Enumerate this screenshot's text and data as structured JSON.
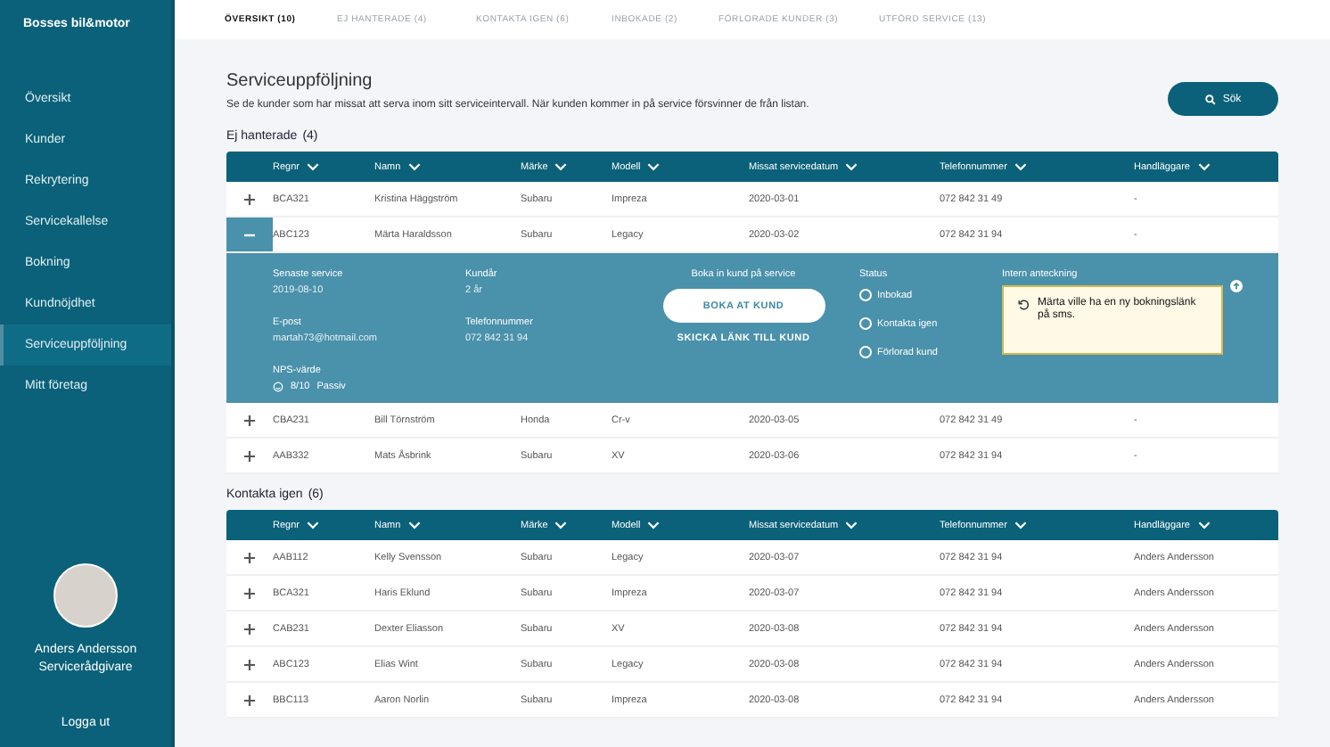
{
  "sidebar": {
    "brand": "Bosses bil&motor",
    "items": [
      {
        "label": "Översikt",
        "selected": false
      },
      {
        "label": "Kunder",
        "selected": false
      },
      {
        "label": "Rekrytering",
        "selected": false
      },
      {
        "label": "Servicekallelse",
        "selected": false
      },
      {
        "label": "Bokning",
        "selected": false
      },
      {
        "label": "Kundnöjdhet",
        "selected": false
      },
      {
        "label": "Serviceuppföljning",
        "selected": true
      },
      {
        "label": "Mitt företag",
        "selected": false
      }
    ],
    "user": {
      "name": "Anders Andersson",
      "role": "Servicerådgivare"
    },
    "logout": "Logga ut"
  },
  "tabs": [
    {
      "label": "ÖVERSIKT",
      "count": "(10)",
      "selected": true
    },
    {
      "label": "EJ HANTERADE",
      "count": "(4)",
      "selected": false
    },
    {
      "label": "KONTAKTA IGEN",
      "count": "(6)",
      "selected": false
    },
    {
      "label": "INBOKADE",
      "count": "(2)",
      "selected": false
    },
    {
      "label": "FÖRLORADE KUNDER",
      "count": "(3)",
      "selected": false
    },
    {
      "label": "UTFÖRD SERVICE",
      "count": "(13)",
      "selected": false
    }
  ],
  "page": {
    "title": "Serviceuppföljning",
    "description": "Se de kunder som har missat att serva inom sitt serviceintervall. När kunden kommer in på service försvinner de från listan.",
    "search_button": "Sök"
  },
  "sections": [
    {
      "title": "Ej hanterade",
      "count": "(4)",
      "columns": [
        "Regnr",
        "Namn",
        "Märke",
        "Modell",
        "Missat servicedatum",
        "Telefonnummer",
        "Handläggare"
      ],
      "rows": [
        {
          "expanded": false,
          "cells": [
            "BCA321",
            "Kristina Häggström",
            "Subaru",
            "Impreza",
            "2020-03-01",
            "072 842 31 49",
            "-"
          ]
        },
        {
          "expanded": true,
          "cells": [
            "ABC123",
            "Märta Haraldsson",
            "Subaru",
            "Legacy",
            "2020-03-02",
            "072 842 31 94",
            "-"
          ],
          "detail": {
            "last_service": {
              "label": "Senaste service",
              "value": "2019-08-10"
            },
            "email": {
              "label": "E-post",
              "value": "martah73@hotmail.com"
            },
            "nps": {
              "label": "NPS-värde",
              "score": "8/10",
              "category": "Passiv"
            },
            "customer_years": {
              "label": "Kundår",
              "value": "2 år"
            },
            "phone": {
              "label": "Telefonnummer",
              "value": "072 842 31 94"
            },
            "booking": {
              "label": "Boka in kund på service",
              "button": "BOKA AT KUND",
              "link": "SKICKA LÄNK TILL KUND"
            },
            "status": {
              "label": "Status",
              "options": [
                {
                  "label": "Inbokad",
                  "selected": false
                },
                {
                  "label": "Kontakta igen",
                  "selected": false
                },
                {
                  "label": "Förlorad kund",
                  "selected": false
                }
              ]
            },
            "note": {
              "label": "Intern anteckning",
              "text": "Märta ville ha en ny bokningslänk på sms."
            }
          }
        },
        {
          "expanded": false,
          "cells": [
            "CBA231",
            "Bill Törnström",
            "Honda",
            "Cr-v",
            "2020-03-05",
            "072 842 31 49",
            "-"
          ]
        },
        {
          "expanded": false,
          "cells": [
            "AAB332",
            "Mats Åsbrink",
            "Subaru",
            "XV",
            "2020-03-06",
            "072 842 31 94",
            "-"
          ]
        }
      ]
    },
    {
      "title": "Kontakta igen",
      "count": "(6)",
      "columns": [
        "Regnr",
        "Namn",
        "Märke",
        "Modell",
        "Missat servicedatum",
        "Telefonnummer",
        "Handläggare"
      ],
      "rows": [
        {
          "expanded": false,
          "cells": [
            "AAB112",
            "Kelly Svensson",
            "Subaru",
            "Legacy",
            "2020-03-07",
            "072 842 31 94",
            "Anders Andersson"
          ]
        },
        {
          "expanded": false,
          "cells": [
            "BCA321",
            "Haris Eklund",
            "Subaru",
            "Impreza",
            "2020-03-07",
            "072 842 31 94",
            "Anders Andersson"
          ]
        },
        {
          "expanded": false,
          "cells": [
            "CAB231",
            "Dexter Eliasson",
            "Subaru",
            "XV",
            "2020-03-08",
            "072 842 31 94",
            "Anders Andersson"
          ]
        },
        {
          "expanded": false,
          "cells": [
            "ABC123",
            "Elias Wint",
            "Subaru",
            "Legacy",
            "2020-03-08",
            "072 842 31 94",
            "Anders Andersson"
          ]
        },
        {
          "expanded": false,
          "cells": [
            "BBC113",
            "Aaron Norlin",
            "Subaru",
            "Impreza",
            "2020-03-08",
            "072 842 31 94",
            "Anders Andersson"
          ]
        }
      ]
    }
  ]
}
